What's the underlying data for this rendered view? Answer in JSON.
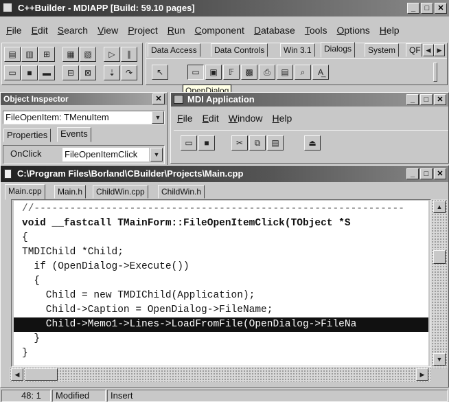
{
  "app": {
    "title": "C++Builder - MDIAPP [Build: 59.10 pages]",
    "menu": [
      "File",
      "Edit",
      "Search",
      "View",
      "Project",
      "Run",
      "Component",
      "Database",
      "Tools",
      "Options",
      "Help"
    ]
  },
  "palette": {
    "tabs": [
      "Data Access",
      "Data Controls",
      "Win 3.1",
      "Dialogs",
      "System",
      "QF"
    ],
    "active_tab": "Dialogs",
    "tooltip": "OpenDialog"
  },
  "inspector": {
    "title": "Object Inspector",
    "selected_object": "FileOpenItem: TMenuItem",
    "tabs": [
      "Properties",
      "Events"
    ],
    "event_name": "OnClick",
    "event_value": "FileOpenItemClick"
  },
  "mdi": {
    "title": "MDI Application",
    "menu": [
      "File",
      "Edit",
      "Window",
      "Help"
    ]
  },
  "editor": {
    "title": "C:\\Program Files\\Borland\\CBuilder\\Projects\\Main.cpp",
    "tabs": [
      "Main.cpp",
      "Main.h",
      "ChildWin.cpp",
      "ChildWin.h"
    ],
    "active_tab": "Main.cpp",
    "lines": [
      "//--------------------------------------------------------------",
      "void __fastcall TMainForm::FileOpenItemClick(TObject *S",
      "{",
      "TMDIChild *Child;",
      "  if (OpenDialog->Execute())",
      "  {",
      "    Child = new TMDIChild(Application);",
      "    Child->Caption = OpenDialog->FileName;",
      "    Child->Memo1->Lines->LoadFromFile(OpenDialog->FileNa",
      "  }",
      "}"
    ],
    "selected_line": 8
  },
  "status": {
    "position": "48: 1",
    "modified": "Modified",
    "mode": "Insert"
  }
}
